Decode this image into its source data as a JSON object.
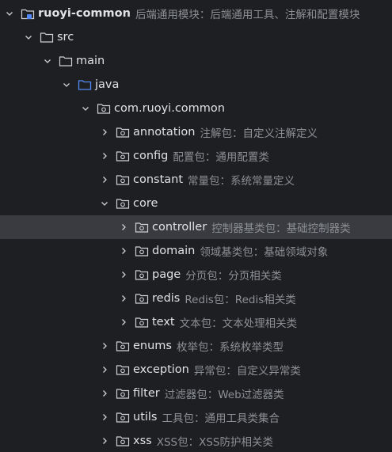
{
  "tree": {
    "root": {
      "name": "ruoyi-common",
      "desc": "后端通用模块：后端通用工具、注解和配置模块",
      "expanded": true,
      "icon": "module-folder-icon"
    },
    "src": {
      "name": "src",
      "expanded": true,
      "icon": "folder-icon"
    },
    "main": {
      "name": "main",
      "expanded": true,
      "icon": "folder-icon"
    },
    "java": {
      "name": "java",
      "expanded": true,
      "icon": "source-root-folder-icon"
    },
    "pkg_common": {
      "name": "com.ruoyi.common",
      "expanded": true,
      "icon": "package-icon"
    },
    "annotation": {
      "name": "annotation",
      "desc": "注解包：自定义注解定义",
      "icon": "package-icon"
    },
    "config": {
      "name": "config",
      "desc": "配置包：通用配置类",
      "icon": "package-icon"
    },
    "constant": {
      "name": "constant",
      "desc": "常量包：系统常量定义",
      "icon": "package-icon"
    },
    "core": {
      "name": "core",
      "expanded": true,
      "icon": "package-icon"
    },
    "controller": {
      "name": "controller",
      "desc": "控制器基类包：基础控制器类",
      "selected": true,
      "icon": "package-icon"
    },
    "domain": {
      "name": "domain",
      "desc": "领域基类包：基础领域对象",
      "icon": "package-icon"
    },
    "page": {
      "name": "page",
      "desc": "分页包：分页相关类",
      "icon": "package-icon"
    },
    "redis": {
      "name": "redis",
      "desc": "Redis包：Redis相关类",
      "icon": "package-icon"
    },
    "text": {
      "name": "text",
      "desc": "文本包：文本处理相关类",
      "icon": "package-icon"
    },
    "enums": {
      "name": "enums",
      "desc": "枚举包：系统枚举类型",
      "icon": "package-icon"
    },
    "exception": {
      "name": "exception",
      "desc": "异常包：自定义异常类",
      "icon": "package-icon"
    },
    "filter": {
      "name": "filter",
      "desc": "过滤器包：Web过滤器类",
      "icon": "package-icon"
    },
    "utils": {
      "name": "utils",
      "desc": "工具包：通用工具类集合",
      "icon": "package-icon"
    },
    "xss": {
      "name": "xss",
      "desc": "XSS包：XSS防护相关类",
      "icon": "package-icon"
    }
  },
  "colors": {
    "background": "#1e1f22",
    "selection": "#393b40",
    "text": "#dfe1e5",
    "desc": "#8c8f94",
    "folder_outline": "#ced0d6",
    "source_root": "#548af7"
  }
}
